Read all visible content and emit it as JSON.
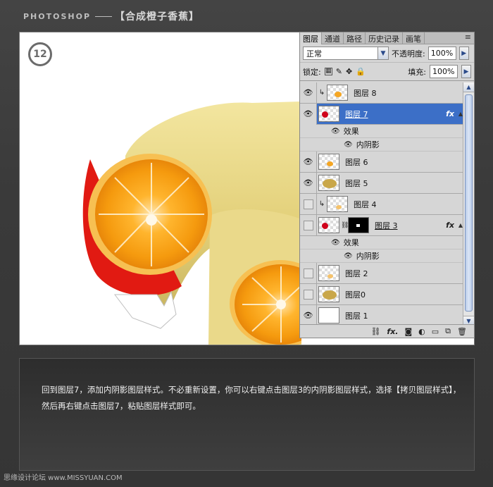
{
  "header": {
    "brand": "PHOTOSHOP",
    "title": "【合成橙子香蕉】"
  },
  "step_number": "12",
  "panel": {
    "tabs": [
      "图层",
      "通道",
      "路径",
      "历史记录",
      "画笔"
    ],
    "menu_icon": "≡",
    "blend_mode": "正常",
    "opacity_label": "不透明度:",
    "opacity_value": "100%",
    "lock_label": "锁定:",
    "fill_label": "填充:",
    "fill_value": "100%",
    "fx_label": "fx",
    "effects_label": "效果",
    "inner_shadow_label": "内阴影",
    "layers": [
      {
        "name": "图层 8",
        "visible": true,
        "clipped": true
      },
      {
        "name": "图层 7",
        "visible": true,
        "selected": true,
        "fx": true
      },
      {
        "name": "图层 6",
        "visible": true
      },
      {
        "name": "图层 5",
        "visible": true
      },
      {
        "name": "图层 4",
        "visible": false,
        "clipped": true
      },
      {
        "name": "图层 3",
        "visible": false,
        "fx": true,
        "mask": true
      },
      {
        "name": "图层 2",
        "visible": false
      },
      {
        "name": "图层0",
        "visible": false
      },
      {
        "name": "图层 1",
        "visible": true
      }
    ],
    "bottom_icons": [
      "link-icon",
      "fx-icon",
      "mask-icon",
      "adjustment-icon",
      "folder-icon",
      "new-layer-icon",
      "trash-icon"
    ]
  },
  "instructions": "回到图层7，添加内阴影图层样式。不必重新设置，你可以右键点击图层3的内阴影图层样式，选择【拷贝图层样式】，然后再右键点击图层7，粘贴图层样式即可。",
  "footer": "思缘设计论坛 www.MISSYUAN.COM"
}
